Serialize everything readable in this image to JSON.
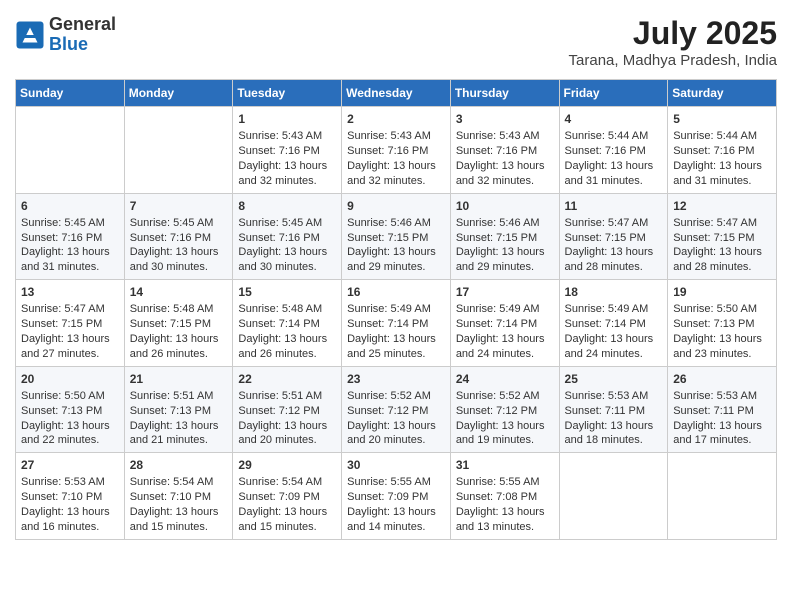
{
  "header": {
    "logo_general": "General",
    "logo_blue": "Blue",
    "month_year": "July 2025",
    "location": "Tarana, Madhya Pradesh, India"
  },
  "days_of_week": [
    "Sunday",
    "Monday",
    "Tuesday",
    "Wednesday",
    "Thursday",
    "Friday",
    "Saturday"
  ],
  "weeks": [
    [
      {
        "day": "",
        "sunrise": "",
        "sunset": "",
        "daylight": ""
      },
      {
        "day": "",
        "sunrise": "",
        "sunset": "",
        "daylight": ""
      },
      {
        "day": "1",
        "sunrise": "Sunrise: 5:43 AM",
        "sunset": "Sunset: 7:16 PM",
        "daylight": "Daylight: 13 hours and 32 minutes."
      },
      {
        "day": "2",
        "sunrise": "Sunrise: 5:43 AM",
        "sunset": "Sunset: 7:16 PM",
        "daylight": "Daylight: 13 hours and 32 minutes."
      },
      {
        "day": "3",
        "sunrise": "Sunrise: 5:43 AM",
        "sunset": "Sunset: 7:16 PM",
        "daylight": "Daylight: 13 hours and 32 minutes."
      },
      {
        "day": "4",
        "sunrise": "Sunrise: 5:44 AM",
        "sunset": "Sunset: 7:16 PM",
        "daylight": "Daylight: 13 hours and 31 minutes."
      },
      {
        "day": "5",
        "sunrise": "Sunrise: 5:44 AM",
        "sunset": "Sunset: 7:16 PM",
        "daylight": "Daylight: 13 hours and 31 minutes."
      }
    ],
    [
      {
        "day": "6",
        "sunrise": "Sunrise: 5:45 AM",
        "sunset": "Sunset: 7:16 PM",
        "daylight": "Daylight: 13 hours and 31 minutes."
      },
      {
        "day": "7",
        "sunrise": "Sunrise: 5:45 AM",
        "sunset": "Sunset: 7:16 PM",
        "daylight": "Daylight: 13 hours and 30 minutes."
      },
      {
        "day": "8",
        "sunrise": "Sunrise: 5:45 AM",
        "sunset": "Sunset: 7:16 PM",
        "daylight": "Daylight: 13 hours and 30 minutes."
      },
      {
        "day": "9",
        "sunrise": "Sunrise: 5:46 AM",
        "sunset": "Sunset: 7:15 PM",
        "daylight": "Daylight: 13 hours and 29 minutes."
      },
      {
        "day": "10",
        "sunrise": "Sunrise: 5:46 AM",
        "sunset": "Sunset: 7:15 PM",
        "daylight": "Daylight: 13 hours and 29 minutes."
      },
      {
        "day": "11",
        "sunrise": "Sunrise: 5:47 AM",
        "sunset": "Sunset: 7:15 PM",
        "daylight": "Daylight: 13 hours and 28 minutes."
      },
      {
        "day": "12",
        "sunrise": "Sunrise: 5:47 AM",
        "sunset": "Sunset: 7:15 PM",
        "daylight": "Daylight: 13 hours and 28 minutes."
      }
    ],
    [
      {
        "day": "13",
        "sunrise": "Sunrise: 5:47 AM",
        "sunset": "Sunset: 7:15 PM",
        "daylight": "Daylight: 13 hours and 27 minutes."
      },
      {
        "day": "14",
        "sunrise": "Sunrise: 5:48 AM",
        "sunset": "Sunset: 7:15 PM",
        "daylight": "Daylight: 13 hours and 26 minutes."
      },
      {
        "day": "15",
        "sunrise": "Sunrise: 5:48 AM",
        "sunset": "Sunset: 7:14 PM",
        "daylight": "Daylight: 13 hours and 26 minutes."
      },
      {
        "day": "16",
        "sunrise": "Sunrise: 5:49 AM",
        "sunset": "Sunset: 7:14 PM",
        "daylight": "Daylight: 13 hours and 25 minutes."
      },
      {
        "day": "17",
        "sunrise": "Sunrise: 5:49 AM",
        "sunset": "Sunset: 7:14 PM",
        "daylight": "Daylight: 13 hours and 24 minutes."
      },
      {
        "day": "18",
        "sunrise": "Sunrise: 5:49 AM",
        "sunset": "Sunset: 7:14 PM",
        "daylight": "Daylight: 13 hours and 24 minutes."
      },
      {
        "day": "19",
        "sunrise": "Sunrise: 5:50 AM",
        "sunset": "Sunset: 7:13 PM",
        "daylight": "Daylight: 13 hours and 23 minutes."
      }
    ],
    [
      {
        "day": "20",
        "sunrise": "Sunrise: 5:50 AM",
        "sunset": "Sunset: 7:13 PM",
        "daylight": "Daylight: 13 hours and 22 minutes."
      },
      {
        "day": "21",
        "sunrise": "Sunrise: 5:51 AM",
        "sunset": "Sunset: 7:13 PM",
        "daylight": "Daylight: 13 hours and 21 minutes."
      },
      {
        "day": "22",
        "sunrise": "Sunrise: 5:51 AM",
        "sunset": "Sunset: 7:12 PM",
        "daylight": "Daylight: 13 hours and 20 minutes."
      },
      {
        "day": "23",
        "sunrise": "Sunrise: 5:52 AM",
        "sunset": "Sunset: 7:12 PM",
        "daylight": "Daylight: 13 hours and 20 minutes."
      },
      {
        "day": "24",
        "sunrise": "Sunrise: 5:52 AM",
        "sunset": "Sunset: 7:12 PM",
        "daylight": "Daylight: 13 hours and 19 minutes."
      },
      {
        "day": "25",
        "sunrise": "Sunrise: 5:53 AM",
        "sunset": "Sunset: 7:11 PM",
        "daylight": "Daylight: 13 hours and 18 minutes."
      },
      {
        "day": "26",
        "sunrise": "Sunrise: 5:53 AM",
        "sunset": "Sunset: 7:11 PM",
        "daylight": "Daylight: 13 hours and 17 minutes."
      }
    ],
    [
      {
        "day": "27",
        "sunrise": "Sunrise: 5:53 AM",
        "sunset": "Sunset: 7:10 PM",
        "daylight": "Daylight: 13 hours and 16 minutes."
      },
      {
        "day": "28",
        "sunrise": "Sunrise: 5:54 AM",
        "sunset": "Sunset: 7:10 PM",
        "daylight": "Daylight: 13 hours and 15 minutes."
      },
      {
        "day": "29",
        "sunrise": "Sunrise: 5:54 AM",
        "sunset": "Sunset: 7:09 PM",
        "daylight": "Daylight: 13 hours and 15 minutes."
      },
      {
        "day": "30",
        "sunrise": "Sunrise: 5:55 AM",
        "sunset": "Sunset: 7:09 PM",
        "daylight": "Daylight: 13 hours and 14 minutes."
      },
      {
        "day": "31",
        "sunrise": "Sunrise: 5:55 AM",
        "sunset": "Sunset: 7:08 PM",
        "daylight": "Daylight: 13 hours and 13 minutes."
      },
      {
        "day": "",
        "sunrise": "",
        "sunset": "",
        "daylight": ""
      },
      {
        "day": "",
        "sunrise": "",
        "sunset": "",
        "daylight": ""
      }
    ]
  ]
}
